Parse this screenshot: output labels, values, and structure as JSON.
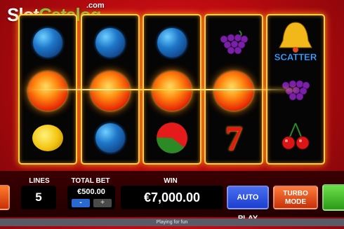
{
  "watermark": {
    "slot": "Slot",
    "catalog": "Catalog",
    "com": ".com"
  },
  "controls": {
    "lines_label": "LINES",
    "lines_value": "5",
    "total_bet_label": "TOTAL BET",
    "total_bet_value": "€500.00",
    "minus_label": "-",
    "plus_label": "+",
    "win_label": "WIN",
    "win_value": "€7,000.00",
    "auto_play_label": "AUTO PLAY",
    "turbo_line1": "TURBO",
    "turbo_line2": "MODE"
  },
  "scatter_label": "SCATTER",
  "seven_label": "7",
  "footer": {
    "status": "Playing for fun"
  },
  "reels": [
    [
      "blue-gem",
      "orange-sun",
      "lemon"
    ],
    [
      "blue-gem",
      "orange-sun",
      "blue-gem"
    ],
    [
      "blue-gem",
      "orange-sun",
      "watermelon"
    ],
    [
      "grapes",
      "orange-sun",
      "seven"
    ],
    [
      "scatter-bell",
      "grapes",
      "cherries"
    ]
  ],
  "colors": {
    "accent_gold": "#ffd23a",
    "spin_green": "#3fb82a",
    "autoplay_blue": "#1a3fd0",
    "turbo_orange": "#e8461a"
  }
}
